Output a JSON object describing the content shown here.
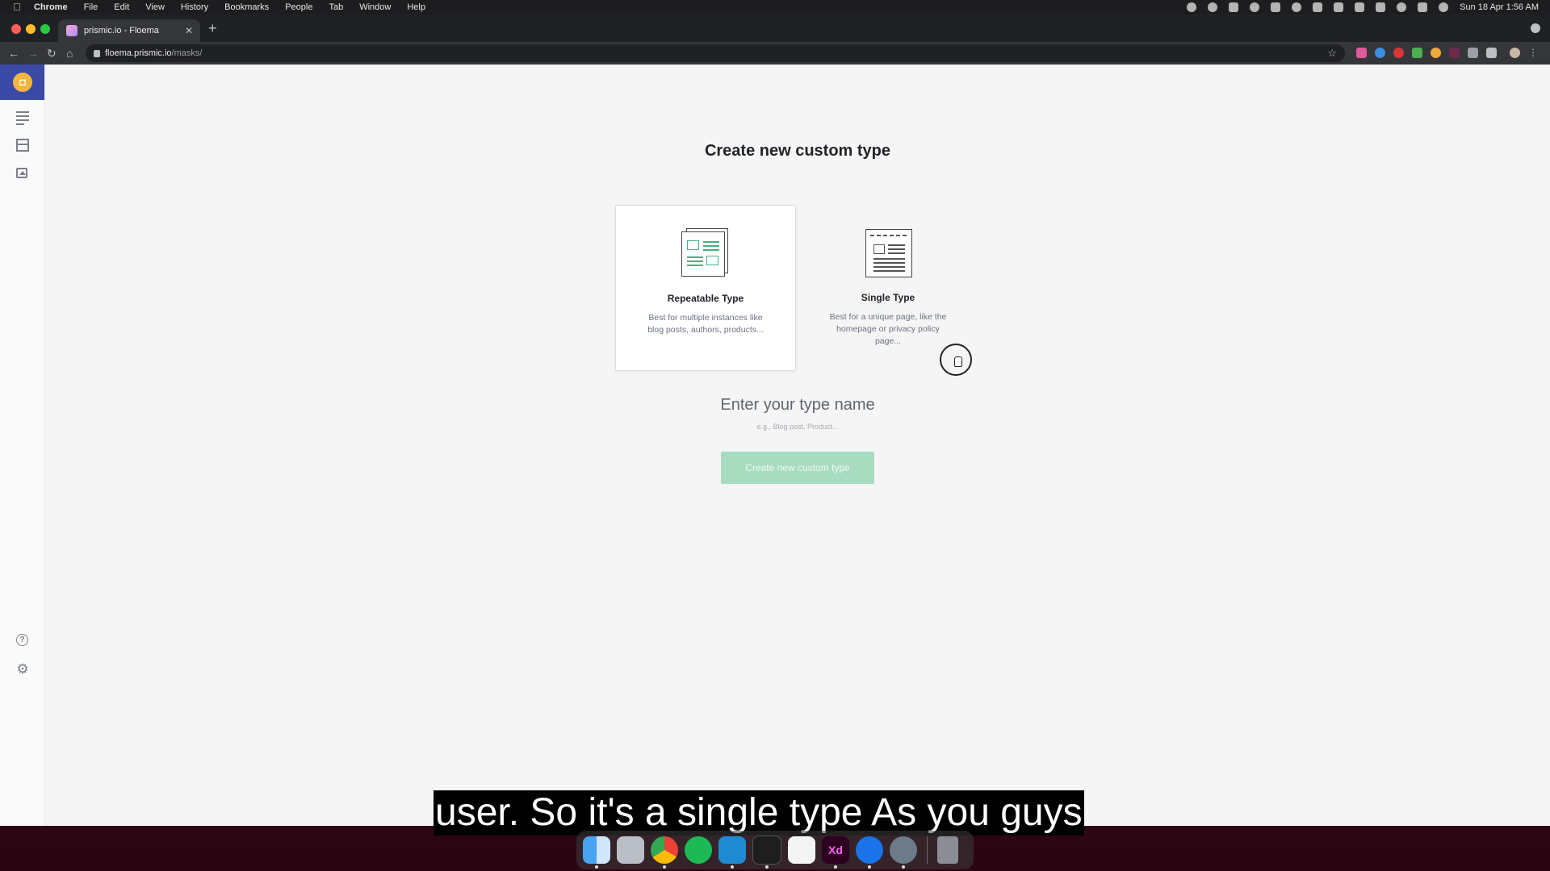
{
  "menubar": {
    "app_name": "Chrome",
    "menus": [
      "File",
      "Edit",
      "View",
      "History",
      "Bookmarks",
      "People",
      "Tab",
      "Window",
      "Help"
    ],
    "clock": "Sun 18 Apr  1:56 AM"
  },
  "browser": {
    "tab_title": "prismic.io - Floema",
    "url_host": "floema.prismic.io",
    "url_path": "/masks/"
  },
  "page": {
    "title": "Create new custom type",
    "options": [
      {
        "name": "Repeatable Type",
        "description": "Best for multiple instances like blog posts, authors, products..."
      },
      {
        "name": "Single Type",
        "description": "Best for a unique page, like the homepage or privacy policy page..."
      }
    ],
    "name_heading": "Enter your type name",
    "name_hint": "e.g., Blog post, Product...",
    "create_button": "Create new custom type"
  },
  "subtitle": "user. So it's a single type As you guys",
  "colors": {
    "sidebar_logo_bg": "#3b4aa6",
    "accent_green": "#3fb37f",
    "button_disabled": "#a8dcc0",
    "chat_launcher": "#3f4fc0"
  },
  "icons": {
    "sidebar": [
      "documents-icon",
      "custom-types-icon",
      "media-icon",
      "help-icon",
      "settings-icon"
    ],
    "dock": [
      "finder",
      "launchpad",
      "chrome",
      "spotify",
      "vscode",
      "terminal",
      "slack",
      "adobe-xd",
      "maps",
      "quicktime",
      "trash"
    ]
  }
}
